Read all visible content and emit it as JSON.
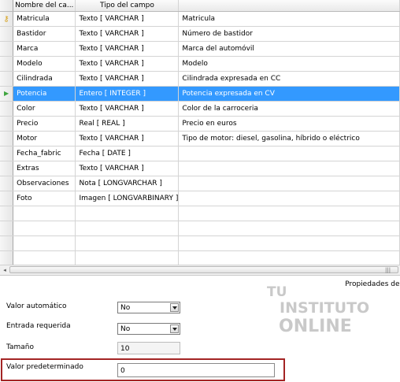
{
  "table": {
    "headers": [
      "Nombre del ca...",
      "Tipo del campo",
      ""
    ],
    "rows": [
      {
        "name": "Matricula",
        "type": "Texto [ VARCHAR ]",
        "desc": "Matricula",
        "key": true
      },
      {
        "name": "Bastidor",
        "type": "Texto [ VARCHAR ]",
        "desc": "Número de bastidor"
      },
      {
        "name": "Marca",
        "type": "Texto [ VARCHAR ]",
        "desc": "Marca del automóvil"
      },
      {
        "name": "Modelo",
        "type": "Texto [ VARCHAR ]",
        "desc": "Modelo"
      },
      {
        "name": "Cilindrada",
        "type": "Texto [ VARCHAR ]",
        "desc": "Cilindrada expresada en CC"
      },
      {
        "name": "Potencia",
        "type": "Entero [ INTEGER ]",
        "desc": "Potencia expresada en CV",
        "active": true
      },
      {
        "name": "Color",
        "type": "Texto [ VARCHAR ]",
        "desc": "Color de la carroceria"
      },
      {
        "name": "Precio",
        "type": "Real [ REAL ]",
        "desc": "Precio en euros"
      },
      {
        "name": "Motor",
        "type": "Texto [ VARCHAR ]",
        "desc": "Tipo de motor: diesel, gasolina, híbrido o eléctrico"
      },
      {
        "name": "Fecha_fabric",
        "type": "Fecha [ DATE ]",
        "desc": ""
      },
      {
        "name": "Extras",
        "type": "Texto [ VARCHAR ]",
        "desc": ""
      },
      {
        "name": "Observaciones",
        "type": "Nota [ LONGVARCHAR ]",
        "desc": ""
      },
      {
        "name": "Foto",
        "type": "Imagen [ LONGVARBINARY ]",
        "desc": ""
      },
      {
        "name": "",
        "type": "",
        "desc": ""
      },
      {
        "name": "",
        "type": "",
        "desc": ""
      },
      {
        "name": "",
        "type": "",
        "desc": ""
      },
      {
        "name": "",
        "type": "",
        "desc": ""
      },
      {
        "name": "",
        "type": "",
        "desc": ""
      }
    ]
  },
  "properties": {
    "title": "Propiedades del",
    "auto_value_label": "Valor automático",
    "auto_value": "No",
    "required_label": "Entrada requerida",
    "required": "No",
    "size_label": "Tamaño",
    "size": "10",
    "default_label": "Valor predeterminado",
    "default_value": "0"
  },
  "watermark": {
    "line1": "TU",
    "line2": "INSTITUTO",
    "line3": "ONLINE"
  },
  "icons": {
    "primary_key": "key-icon",
    "current_row": "row-pointer-icon"
  }
}
